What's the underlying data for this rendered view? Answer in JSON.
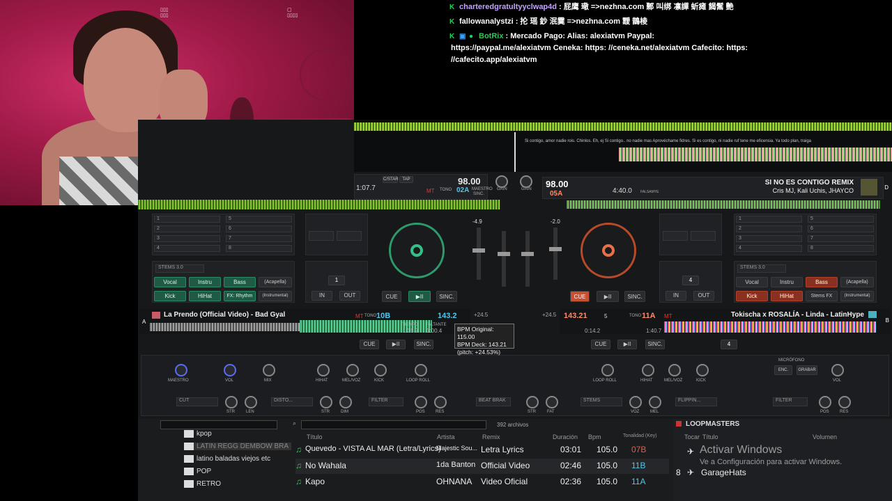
{
  "chat": {
    "messages": [
      {
        "user": "charteredgratultyyclwap4d",
        "text": " : 屁鹰 璥 =>nezhna.com 鄹 叫绑 凛譂 蚚瘫 餲鬗 艶"
      },
      {
        "user": "fallowanalystzi",
        "text": " : 抡 瑶 鈔 泯霙 =>nezhna.com 靉 鵲棱"
      },
      {
        "user": "BotRix",
        "text": " : Mercado Pago: Alias: alexiatvm Paypal:"
      },
      {
        "user": "",
        "text": "https://paypal.me/alexiatvm Ceneka: https: //ceneka.net/alexiatvm Cafecito: https:"
      },
      {
        "user": "",
        "text": "//cafecito.app/alexiatvm"
      }
    ]
  },
  "waveform": {
    "lyrics": "Si contigo, amor nadie rois. Chinlos. Eh, ej   Si contigo.. no nadie mas Aprovéchame fidres.   Si es contigo, ni nadie   ruf tene me eficensia.   Ya todo plan, traiga"
  },
  "deck_left": {
    "time": "1:07.7",
    "bpm": "98.00",
    "key": "02A",
    "master_label": "MAESTRO",
    "sync_label": "SINC.",
    "tap_label": "TAP",
    "cstar_label": "C/STAR",
    "tono": "TONO",
    "mt": "MT",
    "pitch": "-4.9",
    "cue": "CUE",
    "play": "▶II",
    "sinc": "SINC.",
    "hotcues": [
      "1",
      "2",
      "3",
      "4",
      "5",
      "6",
      "7",
      "8"
    ],
    "stems_label": "STEMS 3.0",
    "pads": [
      "Vocal",
      "Instru",
      "Bass",
      "(Acapella)",
      "Kick",
      "HiHat",
      "FX: Rhythm",
      "(Instrumental)"
    ],
    "loop_val": "1",
    "in": "IN",
    "out": "OUT"
  },
  "deck_right": {
    "time": "4:40.0",
    "bpm": "98.00",
    "key": "05A",
    "title": "SI NO ES CONTIGO REMIX",
    "artist": "Cris MJ, Kali Uchis, JHAYCO",
    "deck_letter": "D",
    "pitch": "-2.0",
    "cue": "CUE",
    "play": "▶II",
    "sinc": "SINC.",
    "hotcues": [
      "1",
      "2",
      "3",
      "4",
      "5",
      "6",
      "7",
      "8"
    ],
    "stems_label": "STEMS 3.0",
    "pads": [
      "Vocal",
      "Instru",
      "Bass",
      "(Acapella)",
      "Kick",
      "HiHat",
      "Stems FX",
      "(Instrumental)"
    ],
    "loop_val": "4",
    "in": "IN",
    "out": "OUT",
    "falsamy": "FALSAMYE"
  },
  "deck_a": {
    "letter": "A",
    "title": "La Prendo (Official Video) - Bad Gyal",
    "bpm": "143.2",
    "key": "10B",
    "tono": "TONO",
    "mt": "MT",
    "time1": "1:35.9",
    "time2": "1:00.4",
    "tempo_label": "TIEMPO",
    "falt_label": "FALTANTE",
    "pitch": "+24.5",
    "cue": "CUE",
    "play": "▶II",
    "sinc": "SINC."
  },
  "deck_b": {
    "letter": "B",
    "title": "Tokischa x ROSALÍA - Linda - LatinHype",
    "bpm": "143.21",
    "key": "11A",
    "num": "5",
    "tono": "TONO",
    "mt": "MT",
    "time1": "0:14.2",
    "time2": "1:40.7",
    "pitch": "+24.5",
    "cue": "CUE",
    "play": "▶II",
    "sinc": "SINC.",
    "loop_val": "4"
  },
  "tooltip": {
    "line1": "BPM Original: 115.00",
    "line2": "BPM Deck: 143.21",
    "line3": "(pitch: +24.53%)"
  },
  "mixer": {
    "gain": "GAIN",
    "maestro": "MAESTRO",
    "vol": "VOL",
    "mix": "MIX",
    "hiat": "HIHAT",
    "melvoz": "MEL/VOZ",
    "kick": "KICK",
    "loop_roll": "LOOP ROLL",
    "microfono": "MICRÓFONO",
    "enc": "ENC.",
    "grabar": "GRABAR",
    "vol_r": "VOL",
    "fx_left": [
      "CUT",
      "DISTO...",
      "FILTER"
    ],
    "fx_right": [
      "STEMS",
      "FLIPPIN...",
      "FILTER"
    ],
    "fx_mid": "BEAT BRAK",
    "str": "STR",
    "len": "LEN",
    "dim": "DIM",
    "res": "RES",
    "pos": "POS",
    "voz": "VOZ",
    "mel": "MEL",
    "fat": "FAT"
  },
  "browser": {
    "file_count": "392 archivos",
    "folders": [
      "kpop",
      "LATIN REGG DEMBOW BRA",
      "latino baladas viejos etc",
      "POP",
      "RETRO"
    ],
    "headers": {
      "title": "Título",
      "artist": "Artista",
      "remix": "Remix",
      "duration": "Duración",
      "bpm": "Bpm",
      "key": "Tonalidad (Key)"
    },
    "tracks": [
      {
        "title": "Quevedo - VISTA AL MAR (Letra/Lyrics)",
        "artist": "Majestic Sou...",
        "remix": "Letra Lyrics",
        "duration": "03:01",
        "bpm": "105.0",
        "key": "07B"
      },
      {
        "title": "No Wahala",
        "artist": "1da Banton",
        "remix": "Official Video",
        "duration": "02:46",
        "bpm": "105.0",
        "key": "11B"
      },
      {
        "title": "Kapo",
        "artist": "OHNANA",
        "remix": "Video Oficial",
        "duration": "02:36",
        "bpm": "105.0",
        "key": "11A"
      }
    ],
    "side_title": "LOOPMASTERS",
    "side_headers": {
      "play": "Tocar",
      "title": "Título",
      "volume": "Volumen"
    },
    "side_items": [
      {
        "num": "",
        "title": ""
      },
      {
        "num": "8",
        "title": "GarageHats"
      }
    ]
  },
  "activate_windows": {
    "title": "Activar Windows",
    "subtitle": "Ve a Configuración para activar Windows."
  }
}
